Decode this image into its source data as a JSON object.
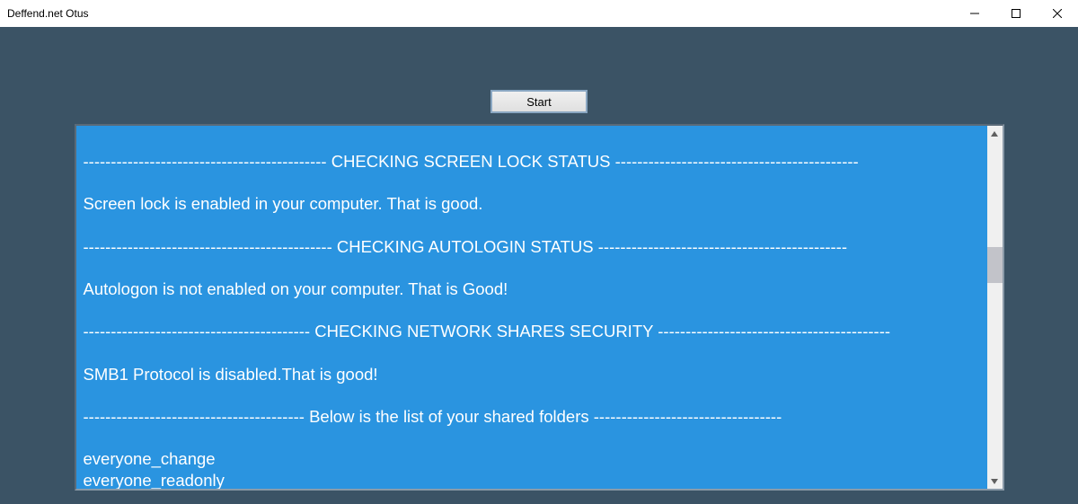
{
  "window": {
    "title": "Deffend.net Otus",
    "minimize": "—",
    "maximize": "☐",
    "close": "✕"
  },
  "controls": {
    "start_label": "Start"
  },
  "output": {
    "lines": [
      "-------------------------------------------- CHECKING SCREEN LOCK STATUS --------------------------------------------",
      "",
      "Screen lock is enabled in your computer. That is good.",
      "",
      "--------------------------------------------- CHECKING AUTOLOGIN STATUS ---------------------------------------------",
      "",
      "Autologon is not enabled on your computer. That is Good!",
      "",
      "----------------------------------------- CHECKING NETWORK SHARES SECURITY ------------------------------------------",
      "",
      "SMB1 Protocol is disabled.That is good!",
      "",
      "---------------------------------------- Below is the list of your shared folders ----------------------------------",
      "",
      "everyone_change",
      "everyone_readonly"
    ]
  }
}
